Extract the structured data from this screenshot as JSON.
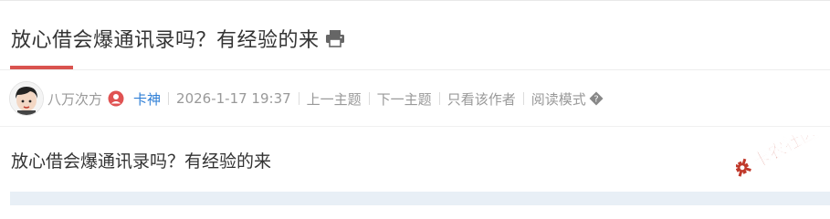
{
  "post": {
    "title": "放心借会爆通讯录吗？有经验的来",
    "content": "放心借会爆通讯录吗？有经验的来"
  },
  "meta": {
    "author": "八万次方",
    "rank": "卡神",
    "timestamp": "2026-1-17 19:37",
    "prev_topic": "上一主题",
    "next_topic": "下一主题",
    "only_author": "只看该作者",
    "read_mode": "阅读模式"
  },
  "icons": {
    "print": "print-icon",
    "user": "user-icon",
    "help": "question-mark-icon",
    "avatar": "cartoon-avatar"
  },
  "watermark": {
    "text": "卡农社区"
  },
  "colors": {
    "accent_red": "#d9534f",
    "rank_blue": "#2f7fd6",
    "meta_gray": "#999999",
    "band_blue": "#e8eff6"
  }
}
